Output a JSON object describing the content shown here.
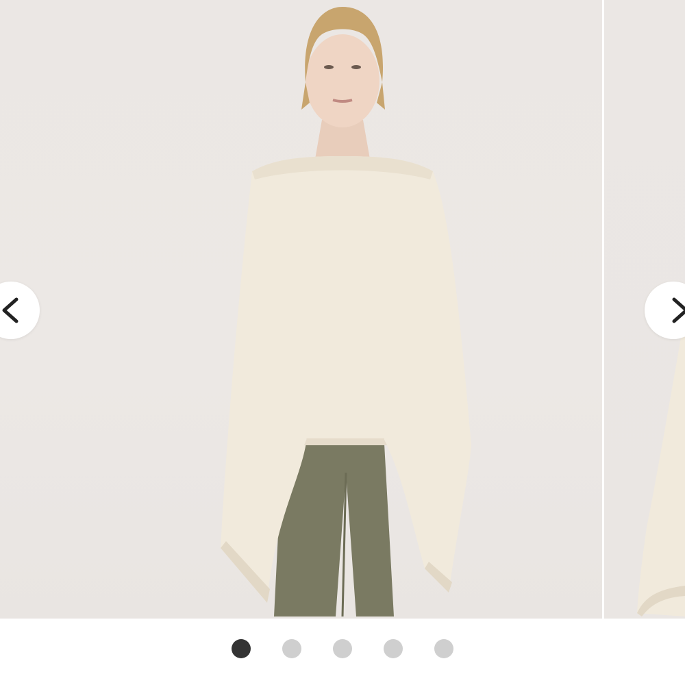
{
  "carousel": {
    "image_count": 5,
    "active_index": 0,
    "prev_icon": "chevron-left-icon",
    "next_icon": "chevron-right-icon"
  },
  "colors": {
    "background": "#ece8e5",
    "active_dot": "#333333",
    "inactive_dot": "#cfcfcf",
    "garment": "#f1eadc",
    "pants": "#7a7a62"
  }
}
